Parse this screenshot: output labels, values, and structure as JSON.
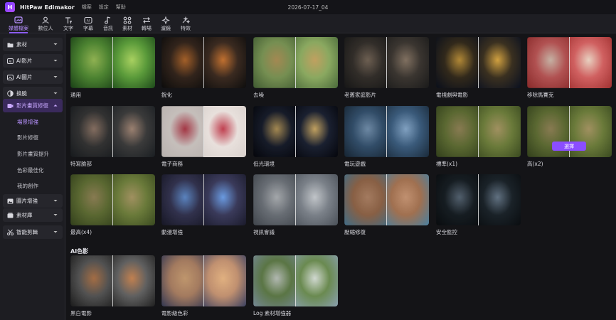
{
  "app": {
    "logo_letter": "H",
    "name": "HitPaw Edimakor",
    "menus": [
      "檔案",
      "設定",
      "幫助"
    ],
    "project_title": "2026-07-17_04"
  },
  "toolbar": [
    {
      "label": "媒體檔案",
      "icon": "media-icon",
      "active": true
    },
    {
      "label": "數位人",
      "icon": "avatar-icon"
    },
    {
      "label": "文字",
      "icon": "text-icon"
    },
    {
      "label": "字幕",
      "icon": "subtitle-icon"
    },
    {
      "label": "音訊",
      "icon": "audio-icon"
    },
    {
      "label": "素材",
      "icon": "assets-icon"
    },
    {
      "label": "轉場",
      "icon": "transition-icon"
    },
    {
      "label": "濾鏡",
      "icon": "filter-icon"
    },
    {
      "label": "特效",
      "icon": "effects-icon"
    }
  ],
  "sidebar": {
    "categories": [
      {
        "label": "素材",
        "icon": "folder-icon",
        "expanded": false
      },
      {
        "label": "AI影片",
        "icon": "ai-video-icon",
        "expanded": false
      },
      {
        "label": "AI圖片",
        "icon": "ai-image-icon",
        "expanded": false
      },
      {
        "label": "換臉",
        "icon": "face-swap-icon",
        "expanded": false
      },
      {
        "label": "影片畫質修復",
        "icon": "video-repair-icon",
        "expanded": true
      },
      {
        "label": "圖片增強",
        "icon": "image-enhance-icon",
        "expanded": false
      },
      {
        "label": "素材庫",
        "icon": "library-icon",
        "expanded": false
      },
      {
        "label": "智能剪輯",
        "icon": "smart-cut-icon",
        "expanded": false
      }
    ],
    "subitems": [
      "場景增強",
      "影片修復",
      "影片畫質提升",
      "色彩最佳化",
      "我的創作"
    ],
    "active_subitem": "場景增強"
  },
  "cards": [
    {
      "label": "通用",
      "palette": [
        "#1d4a1a",
        "#5a9a3a",
        "#a8d060"
      ]
    },
    {
      "label": "銳化",
      "palette": [
        "#0d0d0d",
        "#3a2a20",
        "#c07030"
      ]
    },
    {
      "label": "去噪",
      "palette": [
        "#4a6a3a",
        "#8aa860",
        "#c0a060"
      ]
    },
    {
      "label": "老舊家庭影片",
      "palette": [
        "#1a1a1a",
        "#3a3530",
        "#807060"
      ]
    },
    {
      "label": "電視劇與電影",
      "palette": [
        "#0a1020",
        "#3a3020",
        "#d0a040"
      ]
    },
    {
      "label": "移除馬賽克",
      "palette": [
        "#a03030",
        "#d06060",
        "#e8d0c0"
      ]
    },
    {
      "label": "特寫臉部",
      "palette": [
        "#1a1e22",
        "#3a3a3a",
        "#9a8070"
      ]
    },
    {
      "label": "電子商務",
      "palette": [
        "#d8d0cc",
        "#e8e0dc",
        "#c04050"
      ]
    },
    {
      "label": "低光環境",
      "palette": [
        "#05060c",
        "#1a2030",
        "#c0a060"
      ]
    },
    {
      "label": "電玩遊戲",
      "palette": [
        "#1a2a3a",
        "#3a5a7a",
        "#80a0c0"
      ]
    },
    {
      "label": "標準(x1)",
      "palette": [
        "#3a4a20",
        "#6a7a3a",
        "#a09060"
      ]
    },
    {
      "label": "高(x2)",
      "palette": [
        "#3a4a20",
        "#6a7a3a",
        "#a09060"
      ],
      "hover_button": "選擇"
    },
    {
      "label": "最高(x4)",
      "palette": [
        "#3a4a20",
        "#6a7a3a",
        "#a09060"
      ]
    },
    {
      "label": "動漫增強",
      "palette": [
        "#1a1a2a",
        "#3a3a5a",
        "#6a9ae0"
      ]
    },
    {
      "label": "視訊會議",
      "palette": [
        "#4a5058",
        "#7a8088",
        "#c0c4c8"
      ]
    },
    {
      "label": "壓縮修復",
      "palette": [
        "#4a80a0",
        "#a07050",
        "#c09070"
      ]
    },
    {
      "label": "安全監控",
      "palette": [
        "#0a0d10",
        "#1a2228",
        "#607080"
      ]
    }
  ],
  "ai_section": {
    "title": "AI色影",
    "cards": [
      {
        "label": "黑白電影",
        "palette": [
          "#202020",
          "#606060",
          "#c08050"
        ]
      },
      {
        "label": "電影級色彩",
        "palette": [
          "#3a4060",
          "#c09070",
          "#e0b080"
        ]
      },
      {
        "label": "Log 素材增強器",
        "palette": [
          "#8aa0b0",
          "#6a8a50",
          "#d0d8d0"
        ]
      }
    ]
  }
}
